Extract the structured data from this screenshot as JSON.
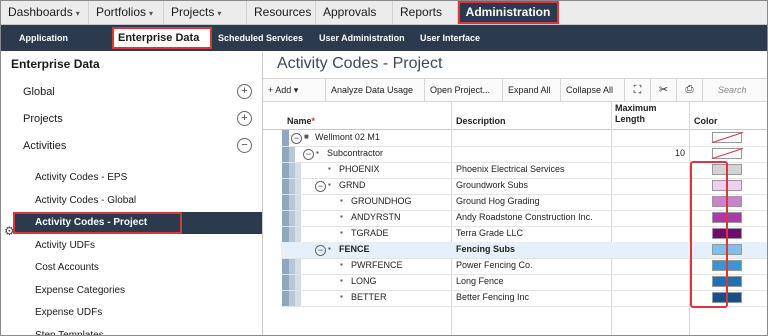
{
  "topnav": [
    {
      "label": "Dashboards",
      "caret": true
    },
    {
      "label": "Portfolios",
      "caret": true
    },
    {
      "label": "Projects",
      "caret": true
    },
    {
      "label": "Resources",
      "caret": false
    },
    {
      "label": "Approvals",
      "caret": false
    },
    {
      "label": "Reports",
      "caret": false
    },
    {
      "label": "Administration",
      "caret": false,
      "active": true
    }
  ],
  "subnav": [
    {
      "label": "Application Settings"
    },
    {
      "label": "Enterprise Data",
      "active": true
    },
    {
      "label": "Scheduled Services"
    },
    {
      "label": "User Administration"
    },
    {
      "label": "User Interface Views"
    }
  ],
  "left": {
    "title": "Enterprise Data",
    "sections": [
      {
        "label": "Global",
        "icon": "plus-circle-icon",
        "symbol": "+"
      },
      {
        "label": "Projects",
        "icon": "plus-circle-icon",
        "symbol": "+"
      },
      {
        "label": "Activities",
        "icon": "minus-circle-icon",
        "symbol": "−"
      }
    ],
    "items": [
      "Activity Codes - EPS",
      "Activity Codes - Global",
      "Activity Codes - Project",
      "Activity UDFs",
      "Cost Accounts",
      "Expense Categories",
      "Expense UDFs",
      "Step Templates"
    ],
    "selected_index": 2
  },
  "page_title": "Activity Codes - Project",
  "toolbar": {
    "add": "+ Add ▾",
    "analyze": "Analyze Data Usage",
    "open_project": "Open Project...",
    "expand": "Expand All",
    "collapse": "Collapse All",
    "fit_icon": "expand-arrows-icon",
    "tools_icon": "tools-icon",
    "print_icon": "print-icon",
    "search_placeholder": "Search"
  },
  "columns": {
    "name": "Name",
    "required_mark": "*",
    "description": "Description",
    "max_length": "Maximum\nLength",
    "color": "Color"
  },
  "rows": [
    {
      "level": 0,
      "toggle": "−",
      "icon": "folder-icon",
      "name": "Wellmont 02 M1",
      "description": "",
      "max_length": "",
      "color": "none",
      "bold": false
    },
    {
      "level": 1,
      "toggle": "−",
      "icon": "code-type-icon",
      "name": "Subcontractor",
      "description": "",
      "max_length": "10",
      "color": "none",
      "bold": false
    },
    {
      "level": 2,
      "toggle": "",
      "icon": "code-value-icon",
      "name": "PHOENIX",
      "description": "Phoenix Electrical Services",
      "max_length": "",
      "color": "#d3d3d3",
      "bold": false
    },
    {
      "level": 2,
      "toggle": "−",
      "icon": "code-value-icon",
      "name": "GRND",
      "description": "Groundwork Subs",
      "max_length": "",
      "color": "#ecd0ec",
      "bold": false
    },
    {
      "level": 3,
      "toggle": "",
      "icon": "code-value-icon",
      "name": "GROUNDHOG",
      "description": "Ground Hog Grading",
      "max_length": "",
      "color": "#c884c8",
      "bold": false
    },
    {
      "level": 3,
      "toggle": "",
      "icon": "code-value-icon",
      "name": "ANDYRSTN",
      "description": "Andy Roadstone Construction Inc.",
      "max_length": "",
      "color": "#a63ca6",
      "bold": false
    },
    {
      "level": 3,
      "toggle": "",
      "icon": "code-value-icon",
      "name": "TGRADE",
      "description": "Terra Grade LLC",
      "max_length": "",
      "color": "#6a0f6a",
      "bold": false
    },
    {
      "level": 2,
      "toggle": "−",
      "icon": "code-value-icon",
      "name": "FENCE",
      "description": "Fencing Subs",
      "max_length": "",
      "color": "#7fbfe8",
      "bold": true
    },
    {
      "level": 3,
      "toggle": "",
      "icon": "code-value-icon",
      "name": "PWRFENCE",
      "description": "Power Fencing Co.",
      "max_length": "",
      "color": "#3f93cf",
      "bold": false
    },
    {
      "level": 3,
      "toggle": "",
      "icon": "code-value-icon",
      "name": "LONG",
      "description": "Long Fence",
      "max_length": "",
      "color": "#2170b0",
      "bold": false
    },
    {
      "level": 3,
      "toggle": "",
      "icon": "code-value-icon",
      "name": "BETTER",
      "description": "Better Fencing Inc",
      "max_length": "",
      "color": "#1a4e86",
      "bold": false
    }
  ],
  "gear_icon": "gear-icon"
}
